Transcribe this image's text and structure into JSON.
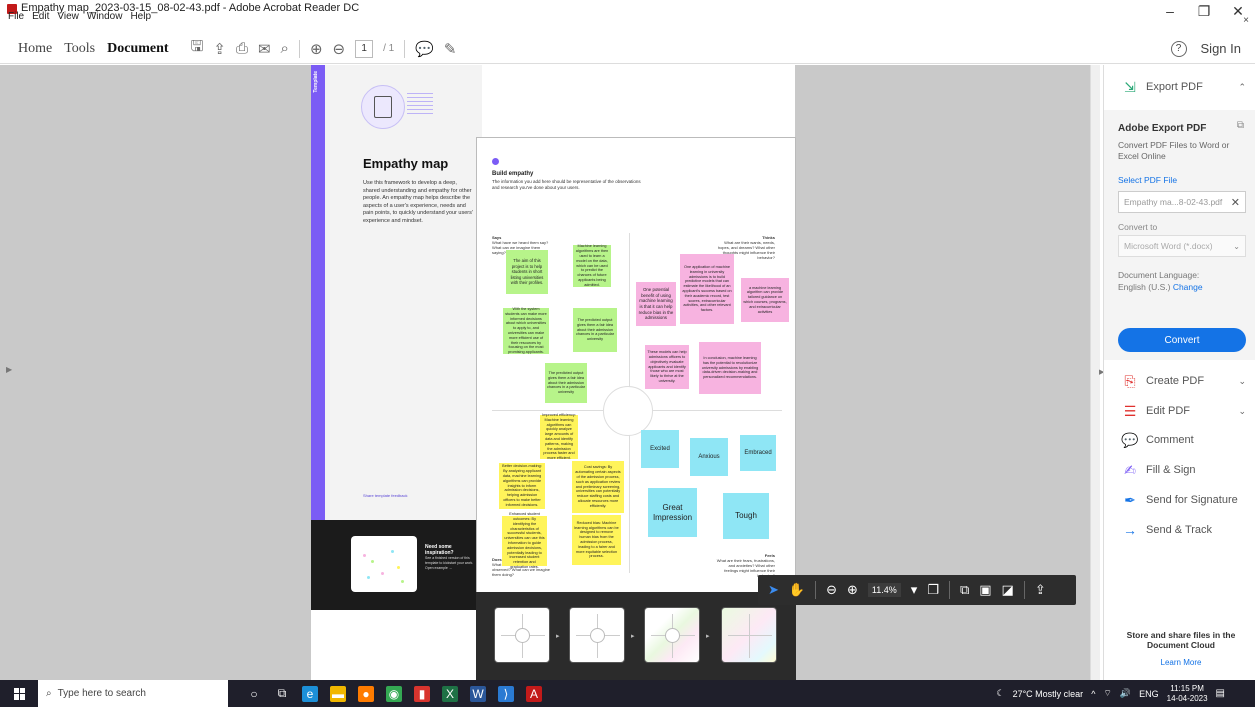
{
  "window": {
    "title": "Empathy map_2023-03-15_08-02-43.pdf - Adobe Acrobat Reader DC",
    "minimize": "–",
    "restore": "❐",
    "close": "✕"
  },
  "menu": [
    "File",
    "Edit",
    "View",
    "Window",
    "Help"
  ],
  "toolbar": {
    "nav": [
      "Home",
      "Tools",
      "Document"
    ],
    "active_nav": "Document",
    "current_page": "1",
    "total_pages": "/ 1",
    "sign_in": "Sign In",
    "help": "?"
  },
  "template_page": {
    "stripe_label": "Template",
    "title": "Empathy map",
    "description": "Use this framework to develop a deep, shared understanding and empathy for other people. An empathy map helps describe the aspects of a user's experience, needs and pain points, to quickly understand your users' experience and mindset.",
    "feedback": "Share template feedback",
    "help_title": "Need some inspiration?",
    "help_sub": "See a finished version of this template to kickstart your work.",
    "help_link": "Open example →"
  },
  "board": {
    "title": "Build empathy",
    "description": "The information you add here should be representative of the observations and research you've done about your users.",
    "quadrants": {
      "says": {
        "title": "Says",
        "desc": "What have we heard them say? What can we imagine them saying?"
      },
      "thinks": {
        "title": "Thinks",
        "desc": "What are their wants, needs, hopes, and dreams? What other thoughts might influence their behavior?"
      },
      "does": {
        "title": "Does",
        "desc": "What behavior have we observed? What can we imagine them doing?"
      },
      "feels": {
        "title": "Feels",
        "desc": "What are their fears, frustrations, and anxieties? What other feelings might influence their behavior?"
      }
    },
    "green_notes": [
      "The aim of this project is to help students in short listing universities with their profiles.",
      "Machine learning algorithms are then used to learn a model on the data, which can be used to predict the chances of future applicants being admitted.",
      "With the system students can make more informed decisions about which universities to apply to, and universities can make more efficient use of their resources by focusing on the most promising applicants.",
      "The predicted output gives them a fair idea about their admission chances in a particular university",
      "The predicted output gives them a fair idea about their admission chances in a particular university"
    ],
    "pink_notes": [
      "One potential benefit of using machine learning is that it can help reduce bias in the admissions",
      "One application of machine learning in university admissions is to build predictive models that can estimate the likelihood of an applicant's success based on their academic record, test scores, extracurricular activities, and other relevant factors.",
      "a machine learning algorithm can provide tailored guidance on which courses, programs, and extracurricular activities",
      "These models can help admissions officers to objectively evaluate applicants and identify those who are most likely to thrive at the university.",
      "In conclusion, machine learning has the potential to revolutionize university admissions by enabling data-driven decision-making and personalized recommendations."
    ],
    "yellow_notes": [
      "Improved efficiency: Machine learning algorithms can quickly analyze large amounts of data and identify patterns, making the admission process faster and more efficient.",
      "Better decision-making: By analyzing applicant data, machine learning algorithms can provide insights to inform admission decisions, helping admission officers to make better informed decisions.",
      "Cost savings: By automating certain aspects of the admission process, such as application review and preliminary screening, universities can potentially reduce staffing costs and allocate resources more efficiently.",
      "Enhanced student outcomes: By identifying the characteristics of successful students, universities can use this information to guide admission decisions, potentially leading to increased student retention and graduation rates.",
      "Reduced bias: Machine learning algorithms can be designed to remove human bias from the admission process, leading to a fairer and more equitable selection process."
    ],
    "blue_notes": [
      "Excited",
      "Anxious",
      "Embraced",
      "Great Impression",
      "Tough"
    ]
  },
  "float_toolbar": {
    "zoom": "11.4%"
  },
  "right_pane": {
    "export_pdf": "Export PDF",
    "adobe_export_title": "Adobe Export PDF",
    "export_desc": "Convert PDF Files to Word or Excel Online",
    "select_file": "Select PDF File",
    "file_name": "Empathy ma...8-02-43.pdf",
    "convert_to": "Convert to",
    "convert_format": "Microsoft Word (*.docx)",
    "doc_language_label": "Document Language:",
    "doc_language": "English (U.S.)",
    "change": "Change",
    "convert_button": "Convert",
    "tools": [
      "Create PDF",
      "Edit PDF",
      "Comment",
      "Fill & Sign",
      "Send for Signature",
      "Send & Track"
    ],
    "cloud_text": "Store and share files in the Document Cloud",
    "learn_more": "Learn More"
  },
  "taskbar": {
    "search_placeholder": "Type here to search",
    "weather": "27°C  Mostly clear",
    "lang": "ENG",
    "time": "11:15 PM",
    "date": "14-04-2023"
  },
  "colors": {
    "accent_blue": "#1473e6",
    "template_purple": "#7b5cf5",
    "sticky_green": "#b7f48a",
    "sticky_pink": "#f7b3e0",
    "sticky_yellow": "#fff45a",
    "sticky_blue": "#8fe6f5"
  }
}
